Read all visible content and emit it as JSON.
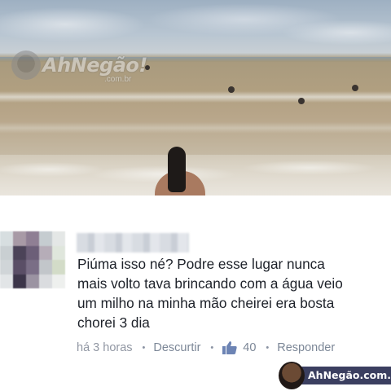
{
  "photo": {
    "watermark": {
      "brand": "AhNegão!",
      "sub": ".com.br"
    }
  },
  "comment": {
    "text": "Piúma isso né? Podre esse lugar nunca\nmais volto tava brincando com a água veio\num milho na minha mão cheirei era bosta\nchorei 3 dia",
    "time": "há 3 horas",
    "unlike_label": "Descurtir",
    "like_count": "40",
    "reply_label": "Responder",
    "separator": "•"
  },
  "badge": {
    "label": "AhNegão.com.br"
  },
  "colors": {
    "link": "#7c8797",
    "text": "#1d2129",
    "badge_bg": "#3b3f60",
    "like_icon": "#6d84b4"
  },
  "icons": {
    "like": "thumbs-up-icon"
  }
}
